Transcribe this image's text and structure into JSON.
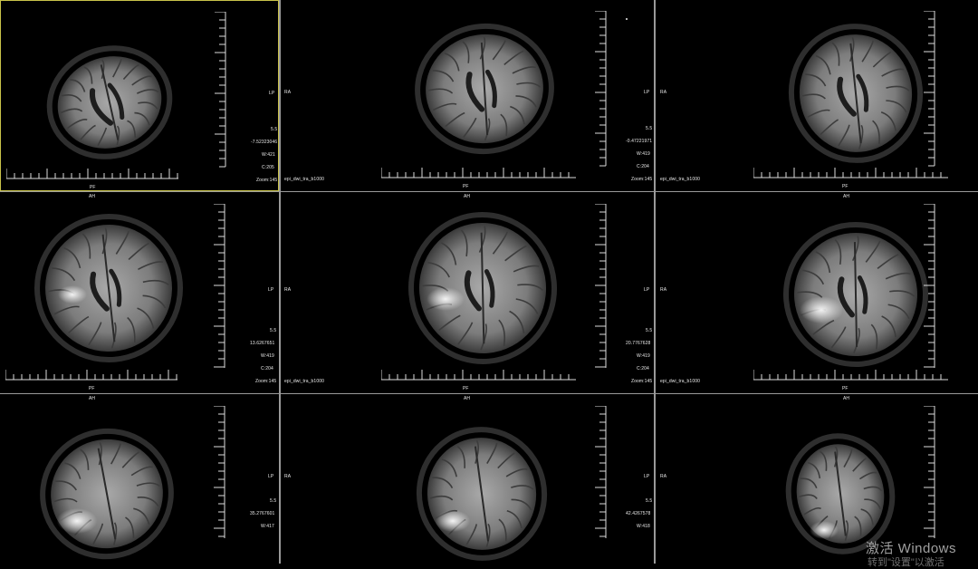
{
  "viewer": {
    "orientation": {
      "left": "LP",
      "right": "RA",
      "top": "AH",
      "bottom": "PF"
    },
    "series_name": "epi_dwi_tra_b1000",
    "slice_thickness_label": "5.5",
    "zoom_label": "Zoom:145"
  },
  "panels": [
    {
      "slice_pos": "-7.52323046",
      "window": "W:421",
      "center": "C:205",
      "selected": true
    },
    {
      "slice_pos": "-0.47221971",
      "window": "W:419",
      "center": "C:204"
    },
    {
      "slice_pos": "",
      "window": "",
      "center": ""
    },
    {
      "slice_pos": "13.6267651",
      "window": "W:419",
      "center": "C:204"
    },
    {
      "slice_pos": "20.7767628",
      "window": "W:419",
      "center": "C:204"
    },
    {
      "slice_pos": "",
      "window": "",
      "center": ""
    },
    {
      "slice_pos": "35.2767601",
      "window": "W:417",
      "center": ""
    },
    {
      "slice_pos": "42.4267578",
      "window": "W:418",
      "center": ""
    },
    {
      "slice_pos": "",
      "window": "",
      "center": ""
    }
  ],
  "os_watermark": {
    "line1": "激活 Windows",
    "line2": "转到\"设置\"以激活"
  }
}
